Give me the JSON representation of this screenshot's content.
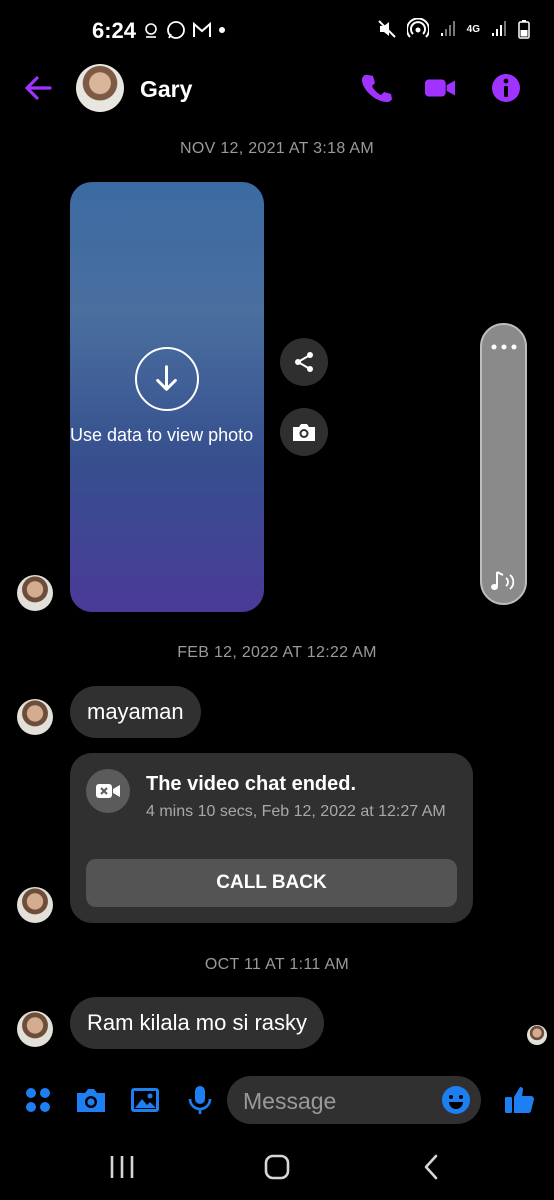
{
  "status_bar": {
    "time": "6:24",
    "net_label": "4G"
  },
  "header": {
    "contact_name": "Gary"
  },
  "thread": {
    "timestamp_1": "NOV 12, 2021 AT 3:18 AM",
    "photo_text": "Use data to view photo",
    "timestamp_2": "FEB 12, 2022 AT 12:22 AM",
    "message_1": "mayaman",
    "call_card": {
      "title": "The video chat ended.",
      "subtitle": "4 mins 10 secs, Feb 12, 2022 at 12:27 AM",
      "button": "CALL BACK"
    },
    "timestamp_3": "OCT 11 AT 1:11 AM",
    "message_2": "Ram kilala mo si rasky"
  },
  "composer": {
    "placeholder": "Message"
  },
  "colors": {
    "accent": "#a033ff",
    "blue": "#1e7ff2",
    "bubble": "#303030"
  },
  "icons": [
    "back-arrow-icon",
    "phone-icon",
    "video-camera-icon",
    "info-icon",
    "download-icon",
    "share-icon",
    "camera-icon",
    "music-note-icon",
    "video-call-icon",
    "apps-icon",
    "gallery-icon",
    "microphone-icon",
    "emoji-icon",
    "thumbs-up-icon"
  ]
}
